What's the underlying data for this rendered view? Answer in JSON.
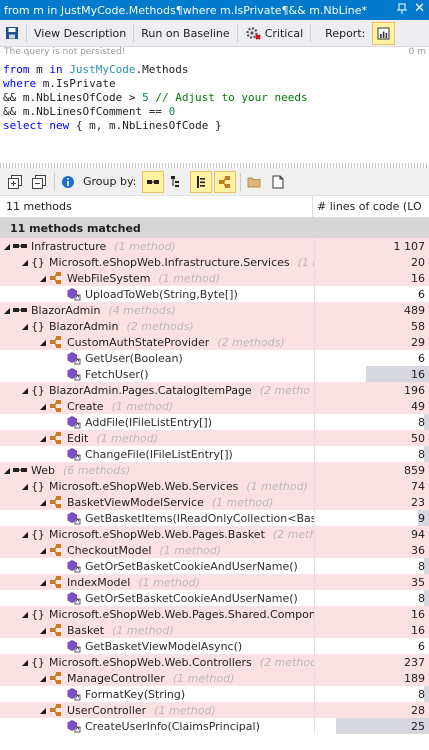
{
  "title": "from m in JustMyCode.Methods¶where m.IsPrivate¶&& m.NbLine*",
  "toolbar": {
    "view_description": "View Description",
    "run_on_baseline": "Run on Baseline",
    "critical": "Critical",
    "report": "Report:"
  },
  "persist_note": "The query is not persisted!",
  "persist_right": "0 m",
  "query": {
    "line1_a": "from",
    "line1_b": " m ",
    "line1_c": "in",
    "line1_d": " ",
    "line1_e": "JustMyCode",
    "line1_f": ".Methods",
    "line2_a": "where",
    "line2_b": " m.IsPrivate",
    "line3_a": "&& m.NbLinesOfCode > ",
    "line3_b": "5",
    "line3_c": " // Adjust to your needs",
    "line4_a": "&& m.NbLinesOfComment == ",
    "line4_b": "0",
    "line5_a": "select",
    "line5_b": " ",
    "line5_c": "new",
    "line5_d": " { m, m.NbLinesOfCode }"
  },
  "group_by_label": "Group by:",
  "columns": {
    "methods": "11 methods",
    "loc": "# lines of code (LO"
  },
  "matched": "11 methods matched",
  "rows": [
    {
      "name": "Infrastructure",
      "count": "(1 method)",
      "value": "1 107",
      "type": "asm",
      "level": 0,
      "pink": true
    },
    {
      "name": "Microsoft.eShopWeb.Infrastructure.Services",
      "count": "(1 m",
      "value": "20",
      "type": "ns",
      "level": 1,
      "pink": true
    },
    {
      "name": "WebFileSystem",
      "count": "(1 method)",
      "value": "16",
      "type": "cls",
      "level": 2,
      "pink": true
    },
    {
      "name": "UploadToWeb(String,Byte[])",
      "count": "",
      "value": "6",
      "type": "meth",
      "level": 3,
      "pink": false,
      "bar": 0
    },
    {
      "name": "BlazorAdmin",
      "count": "(4 methods)",
      "value": "489",
      "type": "asm",
      "level": 0,
      "pink": true
    },
    {
      "name": "BlazorAdmin",
      "count": "(2 methods)",
      "value": "58",
      "type": "ns",
      "level": 1,
      "pink": true
    },
    {
      "name": "CustomAuthStateProvider",
      "count": "(2 methods)",
      "value": "29",
      "type": "cls",
      "level": 2,
      "pink": true
    },
    {
      "name": "GetUser(Boolean)",
      "count": "",
      "value": "6",
      "type": "meth",
      "level": 3,
      "pink": false,
      "bar": 0
    },
    {
      "name": "FetchUser()",
      "count": "",
      "value": "16",
      "type": "meth",
      "level": 3,
      "pink": false,
      "bar": 0.55
    },
    {
      "name": "BlazorAdmin.Pages.CatalogItemPage",
      "count": "(2 metho",
      "value": "196",
      "type": "ns",
      "level": 1,
      "pink": true
    },
    {
      "name": "Create",
      "count": "(1 method)",
      "value": "49",
      "type": "cls",
      "level": 2,
      "pink": true
    },
    {
      "name": "AddFile(IFileListEntry[])",
      "count": "",
      "value": "8",
      "type": "meth",
      "level": 3,
      "pink": false,
      "bar": 0.04
    },
    {
      "name": "Edit",
      "count": "(1 method)",
      "value": "50",
      "type": "cls",
      "level": 2,
      "pink": true
    },
    {
      "name": "ChangeFile(IFileListEntry[])",
      "count": "",
      "value": "8",
      "type": "meth",
      "level": 3,
      "pink": false,
      "bar": 0.04
    },
    {
      "name": "Web",
      "count": "(6 methods)",
      "value": "859",
      "type": "asm",
      "level": 0,
      "pink": true
    },
    {
      "name": "Microsoft.eShopWeb.Web.Services",
      "count": "(1 method)",
      "value": "74",
      "type": "ns",
      "level": 1,
      "pink": true
    },
    {
      "name": "BasketViewModelService",
      "count": "(1 method)",
      "value": "23",
      "type": "cls",
      "level": 2,
      "pink": true
    },
    {
      "name": "GetBasketItems(IReadOnlyCollection<Bask",
      "count": "",
      "value": "9",
      "type": "meth",
      "level": 3,
      "pink": false,
      "bar": 0.1
    },
    {
      "name": "Microsoft.eShopWeb.Web.Pages.Basket",
      "count": "(2 metho",
      "value": "94",
      "type": "ns",
      "level": 1,
      "pink": true
    },
    {
      "name": "CheckoutModel",
      "count": "(1 method)",
      "value": "36",
      "type": "cls",
      "level": 2,
      "pink": true
    },
    {
      "name": "GetOrSetBasketCookieAndUserName()",
      "count": "",
      "value": "8",
      "type": "meth",
      "level": 3,
      "pink": false,
      "bar": 0.04
    },
    {
      "name": "IndexModel",
      "count": "(1 method)",
      "value": "35",
      "type": "cls",
      "level": 2,
      "pink": true
    },
    {
      "name": "GetOrSetBasketCookieAndUserName()",
      "count": "",
      "value": "8",
      "type": "meth",
      "level": 3,
      "pink": false,
      "bar": 0.04
    },
    {
      "name": "Microsoft.eShopWeb.Web.Pages.Shared.Componer",
      "count": "",
      "value": "16",
      "type": "ns",
      "level": 1,
      "pink": true
    },
    {
      "name": "Basket",
      "count": "(1 method)",
      "value": "16",
      "type": "cls",
      "level": 2,
      "pink": true
    },
    {
      "name": "GetBasketViewModelAsync()",
      "count": "",
      "value": "6",
      "type": "meth",
      "level": 3,
      "pink": false,
      "bar": 0
    },
    {
      "name": "Microsoft.eShopWeb.Web.Controllers",
      "count": "(2 methods)",
      "value": "237",
      "type": "ns",
      "level": 1,
      "pink": true
    },
    {
      "name": "ManageController",
      "count": "(1 method)",
      "value": "189",
      "type": "cls",
      "level": 2,
      "pink": true
    },
    {
      "name": "FormatKey(String)",
      "count": "",
      "value": "8",
      "type": "meth",
      "level": 3,
      "pink": false,
      "bar": 0.04
    },
    {
      "name": "UserController",
      "count": "(1 method)",
      "value": "28",
      "type": "cls",
      "level": 2,
      "pink": true
    },
    {
      "name": "CreateUserInfo(ClaimsPrincipal)",
      "count": "",
      "value": "25",
      "type": "meth",
      "level": 3,
      "pink": false,
      "bar": 0.82
    }
  ]
}
